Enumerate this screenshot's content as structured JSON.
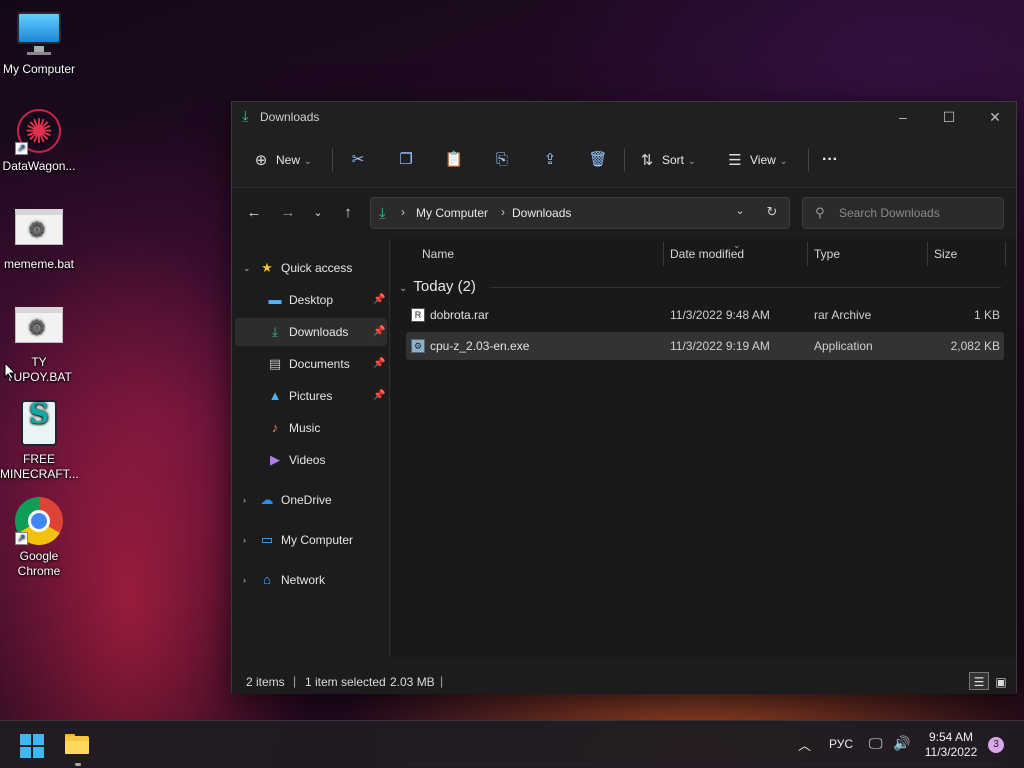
{
  "desktop": {
    "icons": [
      {
        "label": "My Computer"
      },
      {
        "label": "DataWagon..."
      },
      {
        "label": "mememe.bat"
      },
      {
        "label_line1": "TY",
        "label_line2": "TUPOY.BAT"
      },
      {
        "label_line1": "FREE",
        "label_line2": "MINECRAFT..."
      },
      {
        "label_line1": "Google",
        "label_line2": "Chrome"
      }
    ]
  },
  "window": {
    "title": "Downloads",
    "toolbar": {
      "new_label": "New",
      "sort_label": "Sort",
      "view_label": "View",
      "more_label": "···"
    },
    "address": {
      "crumbs": [
        "My Computer",
        "Downloads"
      ]
    },
    "search": {
      "placeholder": "Search Downloads"
    },
    "nav": {
      "quick_access": "Quick access",
      "items": [
        "Desktop",
        "Downloads",
        "Documents",
        "Pictures",
        "Music",
        "Videos"
      ],
      "onedrive": "OneDrive",
      "my_computer": "My Computer",
      "network": "Network"
    },
    "columns": {
      "name": "Name",
      "date": "Date modified",
      "type": "Type",
      "size": "Size"
    },
    "group": {
      "label": "Today (2)"
    },
    "files": [
      {
        "name": "dobrota.rar",
        "date": "11/3/2022 9:48 AM",
        "type": "rar Archive",
        "size": "1 KB"
      },
      {
        "name": "cpu-z_2.03-en.exe",
        "date": "11/3/2022 9:19 AM",
        "type": "Application",
        "size": "2,082 KB"
      }
    ],
    "status": {
      "items": "2 items",
      "selected": "1 item selected",
      "size": "2.03 MB"
    }
  },
  "taskbar": {
    "language": "РУС",
    "time": "9:54 AM",
    "date": "11/3/2022",
    "notifications": "3"
  },
  "colors": {
    "accent": "#2fc49a",
    "selection": "#333333",
    "start": "#3fb7f2"
  }
}
